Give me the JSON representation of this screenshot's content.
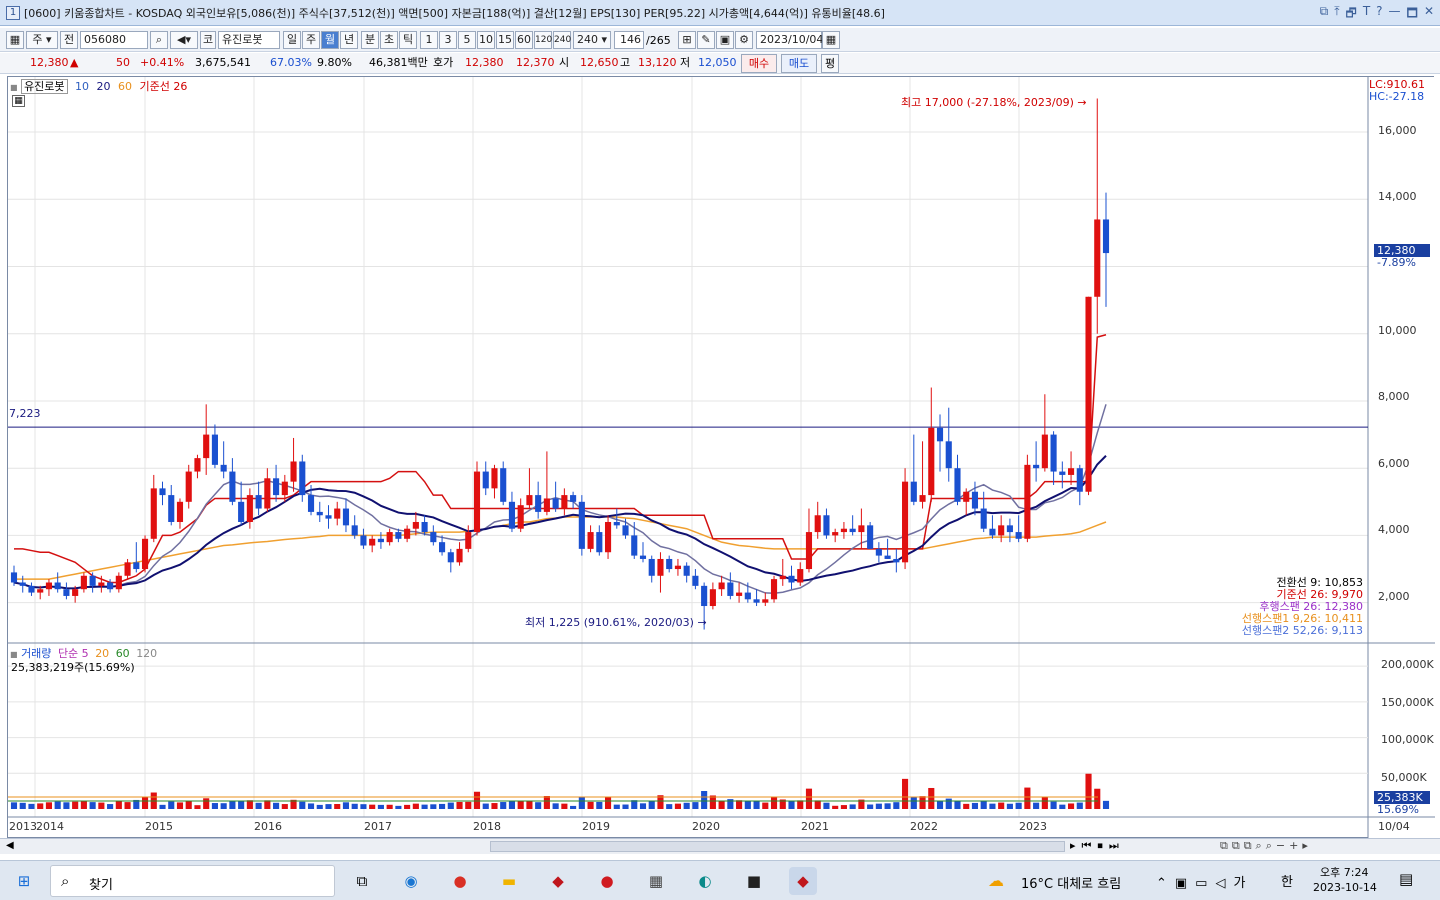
{
  "titlebar": {
    "app_num": "1",
    "text": "[0600] 키움종합차트 - KOSDAQ 외국인보유[5,086(천)] 주식수[37,512(천)] 액면[500] 자본금[188(억)] 결산[12월] EPS[130] PER[95.22] 시가총액[4,644(억)] 유통비율[48.6]",
    "controls": [
      "⧉",
      "⤒",
      "🗗",
      "T",
      "?",
      "—",
      "🗖",
      "✕"
    ]
  },
  "toolbar": {
    "market_btn": "주",
    "prev_btn": "전",
    "code": "056080",
    "kor_btn": "코",
    "stock_name": "유진로봇",
    "periods": [
      "일",
      "주",
      "월",
      "년",
      "분",
      "초",
      "틱"
    ],
    "selected_period": "월",
    "minutes": [
      "1",
      "3",
      "5",
      "10",
      "15",
      "60",
      "120",
      "240"
    ],
    "min_value": "240",
    "count": "146",
    "count_total": "/265",
    "date": "2023/10/04"
  },
  "quote": {
    "price": "12,380",
    "arrow": "▲",
    "change": "50",
    "pct": "+0.41%",
    "volume": "3,675,541",
    "ratio1": "67.03%",
    "ratio2": "9.80%",
    "amount": "46,381백만",
    "bid_label": "호가",
    "bid1": "12,380",
    "bid2": "12,370",
    "open_label": "시",
    "open": "12,650",
    "high_label": "고",
    "high": "13,120",
    "low_label": "저",
    "low": "12,050",
    "buy": "매수",
    "sell": "매도",
    "eval": "평"
  },
  "price_legend": {
    "name": "유진로봇",
    "ma1": "10",
    "ma2": "20",
    "ma3": "60",
    "base": "기준선 26"
  },
  "price_annotations": {
    "lc": "LC:910.61",
    "hc": "HC:-27.18",
    "high_note": "최고 17,000 (-27.18%, 2023/09)",
    "low_note": "최저 1,225 (910.61%, 2020/03)",
    "hline_value": "7,223",
    "current_price": "12,380",
    "current_pct": "-7.89%"
  },
  "ichimoku_legend": [
    {
      "text": "전환선 9: 10,853",
      "color": "#000000"
    },
    {
      "text": "기준선 26: 9,970",
      "color": "#d00000"
    },
    {
      "text": "후행스팬 26: 12,380",
      "color": "#9b30c8"
    },
    {
      "text": "선행스팬1 9,26: 10,411",
      "color": "#e8901e"
    },
    {
      "text": "선행스팬2 52,26: 9,113",
      "color": "#4b6fd8"
    }
  ],
  "price_axis": [
    "16,000",
    "14,000",
    "12,000",
    "10,000",
    "8,000",
    "6,000",
    "4,000",
    "2,000"
  ],
  "volume_legend": {
    "label": "거래량",
    "ma": "단순 5",
    "ma2": "20",
    "ma3": "60",
    "ma4": "120",
    "value": "25,383,219주(15.69%)"
  },
  "volume_axis": [
    "200,000K",
    "150,000K",
    "100,000K",
    "50,000K"
  ],
  "volume_current": "25,383K",
  "volume_current_pct": "15.69%",
  "x_axis": [
    "2013",
    "2014",
    "2015",
    "2016",
    "2017",
    "2018",
    "2019",
    "2020",
    "2021",
    "2022",
    "2023",
    "10/04"
  ],
  "chart_data": {
    "type": "candlestick",
    "period": "monthly",
    "y_range": [
      800,
      17400
    ],
    "candles": [
      [
        2.9,
        3.1,
        2.5,
        2.6
      ],
      [
        2.6,
        2.8,
        2.3,
        2.5
      ],
      [
        2.5,
        2.6,
        2.2,
        2.3
      ],
      [
        2.3,
        2.5,
        2.1,
        2.4
      ],
      [
        2.4,
        2.7,
        2.2,
        2.6
      ],
      [
        2.6,
        2.9,
        2.3,
        2.4
      ],
      [
        2.4,
        2.6,
        2.1,
        2.2
      ],
      [
        2.2,
        2.5,
        2.0,
        2.4
      ],
      [
        2.4,
        2.9,
        2.3,
        2.8
      ],
      [
        2.8,
        2.9,
        2.3,
        2.5
      ],
      [
        2.5,
        2.8,
        2.3,
        2.6
      ],
      [
        2.6,
        2.7,
        2.3,
        2.4
      ],
      [
        2.4,
        2.9,
        2.3,
        2.8
      ],
      [
        2.8,
        3.3,
        2.7,
        3.2
      ],
      [
        3.2,
        3.8,
        2.9,
        3.0
      ],
      [
        3.0,
        4.0,
        2.9,
        3.9
      ],
      [
        3.9,
        5.8,
        3.8,
        5.4
      ],
      [
        5.4,
        5.6,
        4.9,
        5.2
      ],
      [
        5.2,
        5.5,
        4.3,
        4.4
      ],
      [
        4.4,
        5.1,
        4.2,
        5.0
      ],
      [
        5.0,
        6.1,
        4.8,
        5.9
      ],
      [
        5.9,
        6.4,
        5.7,
        6.3
      ],
      [
        6.3,
        7.9,
        5.8,
        7.0
      ],
      [
        7.0,
        7.3,
        6.0,
        6.1
      ],
      [
        6.1,
        6.8,
        5.7,
        5.9
      ],
      [
        5.9,
        6.3,
        4.9,
        5.0
      ],
      [
        5.0,
        5.6,
        4.3,
        4.4
      ],
      [
        4.4,
        5.4,
        4.2,
        5.2
      ],
      [
        5.2,
        5.6,
        4.6,
        4.8
      ],
      [
        4.8,
        6.0,
        4.7,
        5.7
      ],
      [
        5.7,
        6.1,
        5.0,
        5.2
      ],
      [
        5.2,
        5.8,
        5.0,
        5.6
      ],
      [
        5.6,
        6.9,
        5.3,
        6.2
      ],
      [
        6.2,
        6.4,
        5.0,
        5.2
      ],
      [
        5.2,
        5.5,
        4.6,
        4.7
      ],
      [
        4.7,
        5.0,
        4.4,
        4.6
      ],
      [
        4.6,
        4.9,
        4.2,
        4.5
      ],
      [
        4.5,
        5.0,
        4.3,
        4.8
      ],
      [
        4.8,
        5.1,
        4.1,
        4.3
      ],
      [
        4.3,
        4.6,
        3.9,
        4.0
      ],
      [
        4.0,
        4.2,
        3.6,
        3.7
      ],
      [
        3.7,
        4.0,
        3.5,
        3.9
      ],
      [
        3.9,
        4.1,
        3.6,
        3.8
      ],
      [
        3.8,
        4.2,
        3.7,
        4.1
      ],
      [
        4.1,
        4.2,
        3.8,
        3.9
      ],
      [
        3.9,
        4.3,
        3.8,
        4.2
      ],
      [
        4.2,
        4.7,
        4.0,
        4.4
      ],
      [
        4.4,
        4.6,
        4.0,
        4.1
      ],
      [
        4.1,
        4.3,
        3.7,
        3.8
      ],
      [
        3.8,
        4.0,
        3.4,
        3.5
      ],
      [
        3.5,
        3.6,
        2.9,
        3.2
      ],
      [
        3.2,
        3.8,
        3.1,
        3.6
      ],
      [
        3.6,
        4.3,
        3.5,
        4.1
      ],
      [
        4.1,
        6.2,
        4.0,
        5.9
      ],
      [
        5.9,
        6.2,
        5.2,
        5.4
      ],
      [
        5.4,
        6.1,
        5.1,
        6.0
      ],
      [
        6.0,
        6.2,
        4.9,
        5.0
      ],
      [
        5.0,
        5.3,
        4.1,
        4.2
      ],
      [
        4.2,
        5.1,
        4.1,
        4.9
      ],
      [
        4.9,
        6.0,
        4.8,
        5.2
      ],
      [
        5.2,
        5.6,
        4.5,
        4.7
      ],
      [
        4.7,
        6.5,
        4.6,
        5.1
      ],
      [
        5.1,
        5.6,
        4.7,
        4.8
      ],
      [
        4.8,
        5.4,
        4.6,
        5.2
      ],
      [
        5.2,
        5.3,
        4.8,
        5.0
      ],
      [
        5.0,
        5.2,
        3.4,
        3.6
      ],
      [
        3.6,
        4.3,
        3.5,
        4.1
      ],
      [
        4.1,
        4.3,
        3.4,
        3.5
      ],
      [
        3.5,
        4.6,
        3.3,
        4.4
      ],
      [
        4.4,
        4.8,
        4.2,
        4.3
      ],
      [
        4.3,
        4.5,
        3.9,
        4.0
      ],
      [
        4.0,
        4.4,
        3.3,
        3.4
      ],
      [
        3.4,
        3.8,
        3.2,
        3.3
      ],
      [
        3.3,
        3.4,
        2.6,
        2.8
      ],
      [
        2.8,
        3.5,
        2.3,
        3.3
      ],
      [
        3.3,
        3.4,
        2.9,
        3.0
      ],
      [
        3.0,
        3.3,
        2.8,
        3.1
      ],
      [
        3.1,
        3.2,
        2.6,
        2.8
      ],
      [
        2.8,
        3.0,
        2.4,
        2.5
      ],
      [
        2.5,
        2.6,
        1.2,
        1.9
      ],
      [
        1.9,
        2.6,
        1.8,
        2.4
      ],
      [
        2.4,
        2.8,
        2.2,
        2.6
      ],
      [
        2.6,
        2.9,
        2.1,
        2.2
      ],
      [
        2.2,
        2.6,
        2.0,
        2.3
      ],
      [
        2.3,
        2.6,
        2.0,
        2.1
      ],
      [
        2.1,
        2.4,
        1.9,
        2.0
      ],
      [
        2.0,
        2.3,
        1.9,
        2.1
      ],
      [
        2.1,
        2.8,
        2.0,
        2.7
      ],
      [
        2.7,
        3.3,
        2.5,
        2.8
      ],
      [
        2.8,
        3.1,
        2.4,
        2.6
      ],
      [
        2.6,
        3.2,
        2.5,
        3.0
      ],
      [
        3.0,
        4.8,
        2.9,
        4.1
      ],
      [
        4.1,
        5.0,
        3.9,
        4.6
      ],
      [
        4.6,
        4.8,
        3.9,
        4.0
      ],
      [
        4.0,
        4.2,
        3.8,
        4.1
      ],
      [
        4.1,
        4.4,
        3.9,
        4.2
      ],
      [
        4.2,
        4.6,
        4.0,
        4.1
      ],
      [
        4.1,
        4.8,
        3.6,
        4.3
      ],
      [
        4.3,
        4.4,
        3.8,
        3.6
      ],
      [
        3.6,
        3.8,
        3.2,
        3.4
      ],
      [
        3.4,
        3.9,
        3.3,
        3.3
      ],
      [
        3.3,
        3.6,
        2.9,
        3.2
      ],
      [
        3.2,
        6.0,
        3.0,
        5.6
      ],
      [
        5.6,
        7.0,
        4.9,
        5.0
      ],
      [
        5.0,
        6.8,
        4.8,
        5.2
      ],
      [
        5.2,
        8.4,
        5.0,
        7.2
      ],
      [
        7.2,
        7.6,
        5.9,
        6.8
      ],
      [
        6.8,
        7.8,
        5.6,
        6.0
      ],
      [
        6.0,
        6.4,
        4.9,
        5.0
      ],
      [
        5.0,
        5.4,
        4.6,
        5.3
      ],
      [
        5.3,
        5.6,
        4.6,
        4.8
      ],
      [
        4.8,
        5.3,
        4.1,
        4.2
      ],
      [
        4.2,
        4.6,
        3.9,
        4.0
      ],
      [
        4.0,
        4.6,
        3.8,
        4.3
      ],
      [
        4.3,
        4.5,
        3.8,
        4.1
      ],
      [
        4.1,
        4.6,
        3.8,
        3.9
      ],
      [
        3.9,
        6.4,
        3.8,
        6.1
      ],
      [
        6.1,
        6.8,
        5.6,
        6.0
      ],
      [
        6.0,
        8.2,
        5.9,
        7.0
      ],
      [
        7.0,
        7.1,
        5.5,
        5.9
      ],
      [
        5.9,
        6.2,
        5.4,
        5.8
      ],
      [
        5.8,
        6.5,
        5.5,
        6.0
      ],
      [
        6.0,
        6.1,
        4.9,
        5.3
      ],
      [
        5.3,
        11.1,
        5.2,
        11.1
      ],
      [
        11.1,
        17.0,
        10.0,
        13.4
      ],
      [
        13.4,
        14.2,
        10.8,
        12.4
      ]
    ],
    "ma_slow_orange": [
      2.7,
      2.7,
      2.7,
      2.7,
      2.7,
      2.75,
      2.8,
      2.85,
      2.9,
      2.95,
      3.0,
      3.05,
      3.1,
      3.15,
      3.2,
      3.25,
      3.3,
      3.35,
      3.4,
      3.45,
      3.5,
      3.55,
      3.6,
      3.65,
      3.7,
      3.72,
      3.75,
      3.78,
      3.8,
      3.82,
      3.85,
      3.88,
      3.9,
      3.92,
      3.95,
      3.97,
      4.0,
      4.0,
      4.0,
      4.0,
      4.0,
      4.0,
      4.0,
      4.0,
      4.0,
      4.02,
      4.05,
      4.08,
      4.1,
      4.1,
      4.1,
      4.1,
      4.12,
      4.15,
      4.2,
      4.25,
      4.3,
      4.35,
      4.4,
      4.4,
      4.45,
      4.5,
      4.52,
      4.55,
      4.55,
      4.55,
      4.55,
      4.55,
      4.55,
      4.55,
      4.52,
      4.5,
      4.45,
      4.4,
      4.35,
      4.3,
      4.25,
      4.2,
      4.1,
      4.0,
      3.9,
      3.8,
      3.75,
      3.7,
      3.68,
      3.65,
      3.62,
      3.6,
      3.6,
      3.6,
      3.6,
      3.6,
      3.6,
      3.6,
      3.6,
      3.6,
      3.6,
      3.6,
      3.6,
      3.6,
      3.6,
      3.6,
      3.6,
      3.6,
      3.6,
      3.65,
      3.7,
      3.75,
      3.8,
      3.85,
      3.9,
      3.92,
      3.95,
      3.95,
      3.95,
      3.95,
      3.95,
      3.95,
      3.98,
      4.0,
      4.02,
      4.05,
      4.1,
      4.2,
      4.3,
      4.4
    ],
    "base_red": [
      3.6,
      3.6,
      3.55,
      3.5,
      3.5,
      3.4,
      3.3,
      3.2,
      3.0,
      2.8,
      2.7,
      2.6,
      2.6,
      2.7,
      2.8,
      3.0,
      3.5,
      4.0,
      4.0,
      4.1,
      4.3,
      4.5,
      4.9,
      5.1,
      5.1,
      5.1,
      5.1,
      5.1,
      5.1,
      5.1,
      5.1,
      5.1,
      5.2,
      5.4,
      5.6,
      5.6,
      5.6,
      5.6,
      5.6,
      5.6,
      5.6,
      5.6,
      5.6,
      5.7,
      5.9,
      5.9,
      5.9,
      5.6,
      5.2,
      5.2,
      4.8,
      4.8,
      4.8,
      4.8,
      4.8,
      4.8,
      4.8,
      4.8,
      4.8,
      4.8,
      4.8,
      4.8,
      4.8,
      4.8,
      4.8,
      4.8,
      4.8,
      4.8,
      4.8,
      4.8,
      4.8,
      4.8,
      4.6,
      4.6,
      4.6,
      4.6,
      4.6,
      4.6,
      4.6,
      4.6,
      3.9,
      3.9,
      3.9,
      3.9,
      3.9,
      3.9,
      3.9,
      3.9,
      3.9,
      3.3,
      3.3,
      3.3,
      3.6,
      3.6,
      3.6,
      3.6,
      3.6,
      3.6,
      3.6,
      3.6,
      3.6,
      3.6,
      3.6,
      3.6,
      3.6,
      5.1,
      5.1,
      5.1,
      5.1,
      5.1,
      5.1,
      5.1,
      5.1,
      5.1,
      5.1,
      5.1,
      5.1,
      5.3,
      5.6,
      5.6,
      5.6,
      5.6,
      5.6,
      5.6,
      9.9,
      9.97
    ]
  }
}
